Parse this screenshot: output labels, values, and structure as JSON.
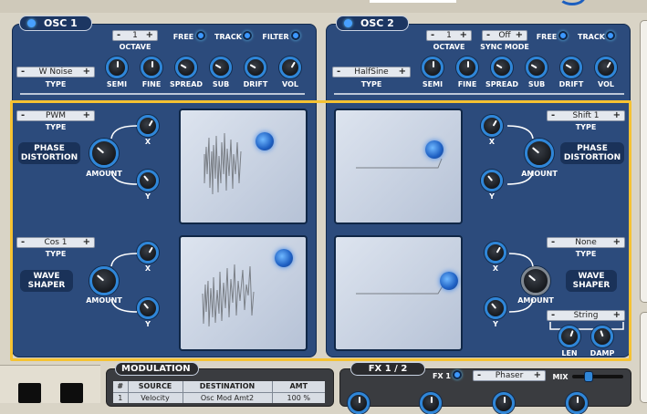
{
  "osc1": {
    "title": "OSC 1",
    "octave_value": "1",
    "octave_label": "OCTAVE",
    "free_label": "FREE",
    "track_label": "TRACK",
    "filter_label": "FILTER",
    "type_value": "W Noise",
    "type_label": "TYPE",
    "knobs": [
      "SEMI",
      "FINE",
      "SPREAD",
      "SUB",
      "DRIFT",
      "VOL"
    ],
    "phase": {
      "type_value": "PWM",
      "type_label": "TYPE",
      "badge": "PHASE DISTORTION",
      "amount_label": "AMOUNT",
      "x_label": "X",
      "y_label": "Y"
    },
    "wave": {
      "type_value": "Cos 1",
      "type_label": "TYPE",
      "badge": "WAVE SHAPER",
      "amount_label": "AMOUNT",
      "x_label": "X",
      "y_label": "Y"
    }
  },
  "osc2": {
    "title": "OSC 2",
    "octave_value": "1",
    "octave_label": "OCTAVE",
    "sync_value": "Off",
    "sync_label": "SYNC MODE",
    "free_label": "FREE",
    "track_label": "TRACK",
    "type_value": "HalfSine",
    "type_label": "TYPE",
    "knobs": [
      "SEMI",
      "FINE",
      "SPREAD",
      "SUB",
      "DRIFT",
      "VOL"
    ],
    "phase": {
      "type_value": "Shift 1",
      "type_label": "TYPE",
      "badge": "PHASE DISTORTION",
      "amount_label": "AMOUNT",
      "x_label": "X",
      "y_label": "Y"
    },
    "wave": {
      "type_value": "None",
      "type_label": "TYPE",
      "badge": "WAVE SHAPER",
      "amount_label": "AMOUNT",
      "x_label": "X",
      "y_label": "Y",
      "string_value": "String",
      "len_label": "LEN",
      "damp_label": "DAMP"
    }
  },
  "modulation": {
    "title": "MODULATION",
    "headers": [
      "#",
      "SOURCE",
      "DESTINATION",
      "AMT"
    ],
    "row1": [
      "1",
      "Velocity",
      "Osc Mod Amt2",
      "100 %"
    ]
  },
  "fx": {
    "title": "FX 1 / 2",
    "fx1_label": "FX 1",
    "effect_value": "Phaser",
    "mix_label": "MIX"
  },
  "spinner": {
    "minus": "-",
    "plus": "+"
  },
  "colors": {
    "panel": "#2c4b7c",
    "accent": "#3c98ff",
    "highlight": "#f5c232",
    "background": "#d9d4c6"
  }
}
